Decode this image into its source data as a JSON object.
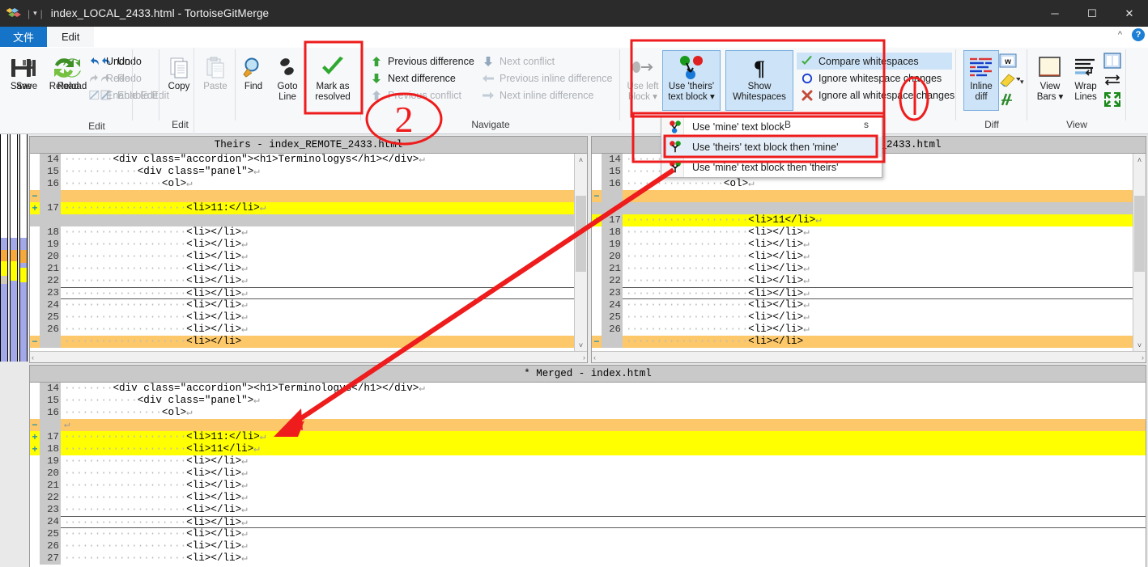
{
  "window": {
    "title": "index_LOCAL_2433.html - TortoiseGitMerge",
    "minimize_label": "─",
    "maximize_label": "☐",
    "close_label": "✕"
  },
  "menubar": {
    "items": [
      {
        "label": "文件",
        "state": "active"
      },
      {
        "label": "Edit",
        "state": "tab"
      }
    ],
    "collapse_icon": "chevron-up-icon",
    "help_icon": "help-icon",
    "help_glyph": "?"
  },
  "ribbon": {
    "groups": [
      {
        "name": "Edit",
        "title": "Edit",
        "big_buttons": [
          {
            "label_line1": "Save",
            "label_line2": "",
            "icon": "save-icon",
            "enabled": true,
            "selected": false
          },
          {
            "label_line1": "Reload",
            "label_line2": "",
            "icon": "reload-icon",
            "enabled": true,
            "selected": false
          },
          {
            "label_line1": "Copy",
            "label_line2": "",
            "icon": "copy-icon",
            "enabled": true,
            "selected": false
          },
          {
            "label_line1": "Paste",
            "label_line2": "",
            "icon": "paste-icon",
            "enabled": false,
            "selected": false
          },
          {
            "label_line1": "Find",
            "label_line2": "",
            "icon": "find-icon",
            "enabled": true,
            "selected": false
          },
          {
            "label_line1": "Goto",
            "label_line2": "Line",
            "icon": "goto-line-icon",
            "enabled": true,
            "selected": false
          },
          {
            "label_line1": "Mark as",
            "label_line2": "resolved",
            "icon": "checkmark-icon",
            "enabled": true,
            "selected": false
          }
        ],
        "small_buttons": [
          {
            "label": "Undo",
            "icon": "undo-icon",
            "enabled": true
          },
          {
            "label": "Redo",
            "icon": "redo-icon",
            "enabled": false
          },
          {
            "label": "Enable Edit",
            "icon": "enable-edit-icon",
            "enabled": false
          }
        ]
      },
      {
        "name": "Navigate",
        "title": "Navigate",
        "col1": [
          {
            "label": "Previous difference",
            "icon": "arrow-up-green-icon",
            "enabled": true
          },
          {
            "label": "Next difference",
            "icon": "arrow-down-green-icon",
            "enabled": true
          },
          {
            "label": "Previous conflict",
            "icon": "arrow-up-gray-icon",
            "enabled": false
          }
        ],
        "col2": [
          {
            "label": "Next conflict",
            "icon": "arrow-down-blue-icon",
            "enabled": false
          },
          {
            "label": "Previous inline difference",
            "icon": "arrow-left-gray-icon",
            "enabled": false
          },
          {
            "label": "Next inline difference",
            "icon": "arrow-right-gray-icon",
            "enabled": false
          }
        ]
      },
      {
        "name": "Blocks",
        "title": "B",
        "big_buttons": [
          {
            "label_line1": "Use left",
            "label_line2": "block ▾",
            "icon": "use-left-block-icon",
            "enabled": false,
            "selected": false
          },
          {
            "label_line1": "Use 'theirs'",
            "label_line2": "text block ▾",
            "icon": "use-theirs-block-icon",
            "enabled": true,
            "selected": true
          },
          {
            "label_line1": "Show",
            "label_line2": "Whitespaces",
            "icon": "pilcrow-icon",
            "enabled": true,
            "selected": true
          }
        ],
        "whitespace_options": [
          {
            "label": "Compare whitespaces",
            "icon": "green-check-icon",
            "selected": true
          },
          {
            "label": "Ignore whitespace changes",
            "icon": "blue-circle-icon",
            "selected": false
          },
          {
            "label": "Ignore all whitespace changes",
            "icon": "red-x-icon",
            "selected": false
          }
        ],
        "trailing_text": "s"
      },
      {
        "name": "Diff",
        "title": "Diff",
        "big_buttons": [
          {
            "label_line1": "Inline",
            "label_line2": "diff",
            "icon": "inline-diff-icon",
            "enabled": true,
            "selected": true
          }
        ],
        "small_buttons": [
          {
            "label": "",
            "icon": "compare-words-icon",
            "enabled": true
          },
          {
            "label": "",
            "icon": "highlighter-icon",
            "enabled": true
          },
          {
            "label": "",
            "icon": "movedblocks-icon",
            "enabled": true
          }
        ]
      },
      {
        "name": "View",
        "title": "View",
        "big_buttons": [
          {
            "label_line1": "View",
            "label_line2": "Bars ▾",
            "icon": "view-bars-icon",
            "enabled": true,
            "selected": false
          },
          {
            "label_line1": "Wrap",
            "label_line2": "Lines",
            "icon": "wrap-lines-icon",
            "enabled": true,
            "selected": false
          }
        ],
        "small_buttons": [
          {
            "label": "",
            "icon": "one-pane-icon",
            "enabled": true
          },
          {
            "label": "",
            "icon": "swap-icon",
            "enabled": true
          },
          {
            "label": "",
            "icon": "collapse-icon",
            "enabled": true
          }
        ]
      }
    ]
  },
  "dropdown_menu": {
    "items": [
      {
        "label": "Use 'mine' text block",
        "icon": "mine-block-icon",
        "highlighted": false
      },
      {
        "label": "Use 'theirs' text block then 'mine'",
        "icon": "theirs-then-mine-icon",
        "highlighted": true
      },
      {
        "label": "Use 'mine' text block then 'theirs'",
        "icon": "mine-then-theirs-icon",
        "highlighted": false
      }
    ]
  },
  "panes": {
    "left": {
      "title": "Theirs - index_REMOTE_2433.html",
      "scroll_up_glyph": "˄",
      "scroll_down_glyph": "˅",
      "hscroll_left_glyph": "‹",
      "hscroll_right_glyph": "›",
      "lines": [
        {
          "num": "14",
          "mark": "",
          "indent": 8,
          "code": "<div class=\"accordion\"><h1>Terminologys</h1></div>",
          "eol": true,
          "type": "normal"
        },
        {
          "num": "15",
          "mark": "",
          "indent": 12,
          "code": "<div class=\"panel\">",
          "eol": true,
          "type": "normal"
        },
        {
          "num": "16",
          "mark": "",
          "indent": 16,
          "code": "<ol>",
          "eol": true,
          "type": "normal"
        },
        {
          "num": "",
          "mark": "−",
          "indent": 0,
          "code": "",
          "eol": false,
          "type": "empty"
        },
        {
          "num": "17",
          "mark": "+",
          "indent": 20,
          "code": "<li>11:</li>",
          "eol": true,
          "type": "add"
        },
        {
          "num": "",
          "mark": "",
          "indent": 0,
          "code": "",
          "eol": false,
          "type": "gray"
        },
        {
          "num": "18",
          "mark": "",
          "indent": 20,
          "code": "<li></li>",
          "eol": true,
          "type": "normal"
        },
        {
          "num": "19",
          "mark": "",
          "indent": 20,
          "code": "<li></li>",
          "eol": true,
          "type": "normal"
        },
        {
          "num": "20",
          "mark": "",
          "indent": 20,
          "code": "<li></li>",
          "eol": true,
          "type": "normal"
        },
        {
          "num": "21",
          "mark": "",
          "indent": 20,
          "code": "<li></li>",
          "eol": true,
          "type": "normal"
        },
        {
          "num": "22",
          "mark": "",
          "indent": 20,
          "code": "<li></li>",
          "eol": true,
          "type": "normal"
        },
        {
          "num": "23",
          "mark": "",
          "indent": 20,
          "code": "<li></li>",
          "eol": true,
          "type": "cursor"
        },
        {
          "num": "24",
          "mark": "",
          "indent": 20,
          "code": "<li></li>",
          "eol": true,
          "type": "normal"
        },
        {
          "num": "25",
          "mark": "",
          "indent": 20,
          "code": "<li></li>",
          "eol": true,
          "type": "normal"
        },
        {
          "num": "26",
          "mark": "",
          "indent": 20,
          "code": "<li></li>",
          "eol": true,
          "type": "normal"
        },
        {
          "num": "",
          "mark": "−",
          "indent": 20,
          "code": "<li></li>",
          "eol": false,
          "type": "empty"
        }
      ]
    },
    "right": {
      "title": "CAL_2433.html",
      "scroll_up_glyph": "˄",
      "scroll_down_glyph": "˅",
      "hscroll_left_glyph": "‹",
      "hscroll_right_glyph": "›",
      "lines": [
        {
          "num": "14",
          "mark": "",
          "indent": 8,
          "code": "ogys</h1></div>",
          "eol": true,
          "type": "normal"
        },
        {
          "num": "15",
          "mark": "",
          "indent": 12,
          "code": "",
          "eol": true,
          "type": "normal"
        },
        {
          "num": "16",
          "mark": "",
          "indent": 16,
          "code": "<ol>",
          "eol": true,
          "type": "normal"
        },
        {
          "num": "",
          "mark": "−",
          "indent": 0,
          "code": "",
          "eol": false,
          "type": "empty"
        },
        {
          "num": "",
          "mark": "",
          "indent": 0,
          "code": "",
          "eol": false,
          "type": "gray"
        },
        {
          "num": "17",
          "mark": "+",
          "indent": 20,
          "code": "<li>11</li>",
          "eol": true,
          "type": "add"
        },
        {
          "num": "18",
          "mark": "",
          "indent": 20,
          "code": "<li></li>",
          "eol": true,
          "type": "normal"
        },
        {
          "num": "19",
          "mark": "",
          "indent": 20,
          "code": "<li></li>",
          "eol": true,
          "type": "normal"
        },
        {
          "num": "20",
          "mark": "",
          "indent": 20,
          "code": "<li></li>",
          "eol": true,
          "type": "normal"
        },
        {
          "num": "21",
          "mark": "",
          "indent": 20,
          "code": "<li></li>",
          "eol": true,
          "type": "normal"
        },
        {
          "num": "22",
          "mark": "",
          "indent": 20,
          "code": "<li></li>",
          "eol": true,
          "type": "normal"
        },
        {
          "num": "23",
          "mark": "",
          "indent": 20,
          "code": "<li></li>",
          "eol": true,
          "type": "cursor"
        },
        {
          "num": "24",
          "mark": "",
          "indent": 20,
          "code": "<li></li>",
          "eol": true,
          "type": "normal"
        },
        {
          "num": "25",
          "mark": "",
          "indent": 20,
          "code": "<li></li>",
          "eol": true,
          "type": "normal"
        },
        {
          "num": "26",
          "mark": "",
          "indent": 20,
          "code": "<li></li>",
          "eol": true,
          "type": "normal"
        },
        {
          "num": "",
          "mark": "−",
          "indent": 20,
          "code": "<li></li>",
          "eol": false,
          "type": "empty"
        }
      ]
    },
    "merged": {
      "title": "* Merged - index.html",
      "lines": [
        {
          "num": "14",
          "mark": "",
          "indent": 8,
          "code": "<div class=\"accordion\"><h1>Terminologys</h1></div>",
          "eol": true,
          "type": "normal"
        },
        {
          "num": "15",
          "mark": "",
          "indent": 12,
          "code": "<div class=\"panel\">",
          "eol": true,
          "type": "normal"
        },
        {
          "num": "16",
          "mark": "",
          "indent": 16,
          "code": "<ol>",
          "eol": true,
          "type": "normal"
        },
        {
          "num": "",
          "mark": "−",
          "indent": 0,
          "code": "",
          "eol": true,
          "type": "empty"
        },
        {
          "num": "17",
          "mark": "+",
          "indent": 20,
          "code": "<li>11:</li>",
          "eol": true,
          "type": "add"
        },
        {
          "num": "18",
          "mark": "+",
          "indent": 20,
          "code": "<li>11</li>",
          "eol": true,
          "type": "add"
        },
        {
          "num": "19",
          "mark": "",
          "indent": 20,
          "code": "<li></li>",
          "eol": true,
          "type": "normal"
        },
        {
          "num": "20",
          "mark": "",
          "indent": 20,
          "code": "<li></li>",
          "eol": true,
          "type": "normal"
        },
        {
          "num": "21",
          "mark": "",
          "indent": 20,
          "code": "<li></li>",
          "eol": true,
          "type": "normal"
        },
        {
          "num": "22",
          "mark": "",
          "indent": 20,
          "code": "<li></li>",
          "eol": true,
          "type": "normal"
        },
        {
          "num": "23",
          "mark": "",
          "indent": 20,
          "code": "<li></li>",
          "eol": true,
          "type": "normal"
        },
        {
          "num": "24",
          "mark": "",
          "indent": 20,
          "code": "<li></li>",
          "eol": true,
          "type": "cursor"
        },
        {
          "num": "25",
          "mark": "",
          "indent": 20,
          "code": "<li></li>",
          "eol": true,
          "type": "normal"
        },
        {
          "num": "26",
          "mark": "",
          "indent": 20,
          "code": "<li></li>",
          "eol": true,
          "type": "normal"
        },
        {
          "num": "27",
          "mark": "",
          "indent": 20,
          "code": "<li></li>",
          "eol": true,
          "type": "normal"
        }
      ]
    }
  },
  "annotations": {
    "number_2": "2",
    "number_1": "1",
    "color": "#ee1c1c"
  },
  "colors": {
    "titlebar_bg": "#2b2b2b",
    "menu_active": "#1573c8",
    "added_line": "#ffff00",
    "empty_line": "#fcc86a",
    "selected_button": "#cde3f7",
    "pane_header": "#c9c9c9",
    "locator_diff": "#a3a8e8",
    "annotation_red": "#ee1c1c"
  }
}
